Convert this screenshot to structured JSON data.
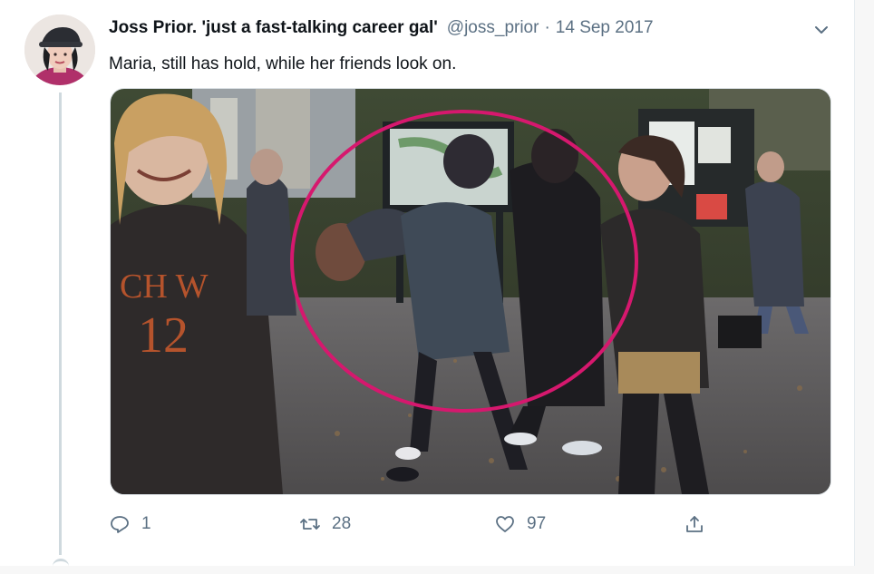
{
  "tweet": {
    "display_name": "Joss Prior. 'just a fast-talking career gal'",
    "handle": "@joss_prior",
    "separator": "·",
    "date": "14 Sep 2017",
    "text": "Maria, still has hold, while her friends look on.",
    "more_icon": "chevron-down-icon",
    "media_icon": "photo"
  },
  "actions": {
    "reply": {
      "icon": "reply-icon",
      "count": "1"
    },
    "retweet": {
      "icon": "retweet-icon",
      "count": "28"
    },
    "like": {
      "icon": "heart-icon",
      "count": "97"
    },
    "share": {
      "icon": "share-icon"
    }
  },
  "colors": {
    "secondary_text": "#5b7083",
    "circle_annotation": "#d6186e",
    "thread_line": "#cfd9de"
  }
}
